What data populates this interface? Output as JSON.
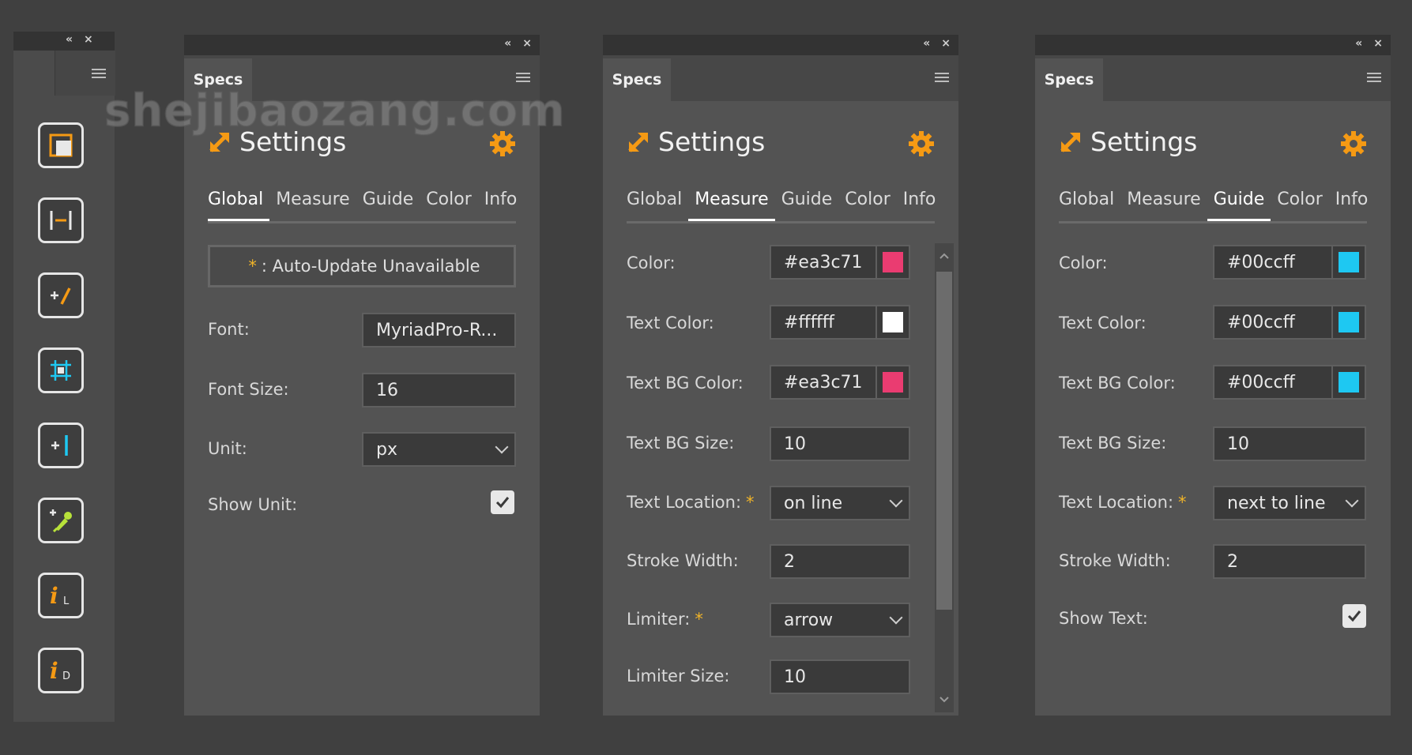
{
  "header_glyphs": {
    "collapse": "«",
    "close": "×"
  },
  "watermark": "shejibaozang.com",
  "toolbar": {
    "tools": [
      {
        "name": "artboard-tool-icon"
      },
      {
        "name": "measure-width-tool-icon"
      },
      {
        "name": "add-measure-tool-icon"
      },
      {
        "name": "measure-selection-tool-icon"
      },
      {
        "name": "add-guide-tool-icon"
      },
      {
        "name": "color-picker-tool-icon"
      },
      {
        "name": "info-layer-tool-icon",
        "glyph": "i",
        "sub": "L"
      },
      {
        "name": "info-doc-tool-icon",
        "glyph": "i",
        "sub": "D"
      }
    ]
  },
  "panels": {
    "global": {
      "tab": "Specs",
      "title": "Settings",
      "subtabs": [
        "Global",
        "Measure",
        "Guide",
        "Color",
        "Info"
      ],
      "notice": {
        "star": "*",
        "text": ": Auto-Update Unavailable"
      },
      "fields": {
        "font": {
          "label": "Font:",
          "value": "MyriadPro-R..."
        },
        "font_size": {
          "label": "Font Size:",
          "value": "16"
        },
        "unit": {
          "label": "Unit:",
          "value": "px"
        },
        "show_unit": {
          "label": "Show Unit:",
          "checked": true
        }
      }
    },
    "measure": {
      "tab": "Specs",
      "title": "Settings",
      "subtabs": [
        "Global",
        "Measure",
        "Guide",
        "Color",
        "Info"
      ],
      "fields": {
        "color": {
          "label": "Color:",
          "value": "#ea3c71",
          "swatch": "#ea3c71"
        },
        "text_color": {
          "label": "Text Color:",
          "value": "#ffffff",
          "swatch": "#ffffff"
        },
        "text_bg_color": {
          "label": "Text BG Color:",
          "value": "#ea3c71",
          "swatch": "#ea3c71"
        },
        "text_bg_size": {
          "label": "Text BG Size:",
          "value": "10"
        },
        "text_location": {
          "label": "Text Location:",
          "star": "*",
          "value": "on line"
        },
        "stroke_width": {
          "label": "Stroke Width:",
          "value": "2"
        },
        "limiter": {
          "label": "Limiter:",
          "star": "*",
          "value": "arrow"
        },
        "limiter_size": {
          "label": "Limiter Size:",
          "value": "10"
        }
      }
    },
    "guide": {
      "tab": "Specs",
      "title": "Settings",
      "subtabs": [
        "Global",
        "Measure",
        "Guide",
        "Color",
        "Info"
      ],
      "fields": {
        "color": {
          "label": "Color:",
          "value": "#00ccff",
          "swatch": "#1ec8f2"
        },
        "text_color": {
          "label": "Text Color:",
          "value": "#00ccff",
          "swatch": "#1ec8f2"
        },
        "text_bg_color": {
          "label": "Text BG Color:",
          "value": "#00ccff",
          "swatch": "#1ec8f2"
        },
        "text_bg_size": {
          "label": "Text BG Size:",
          "value": "10"
        },
        "text_location": {
          "label": "Text Location:",
          "star": "*",
          "value": "next to line"
        },
        "stroke_width": {
          "label": "Stroke Width:",
          "value": "2"
        },
        "show_text": {
          "label": "Show Text:",
          "checked": true
        }
      }
    }
  },
  "colors": {
    "accent": "#f59a14",
    "background": "#404040",
    "panel": "#535353"
  }
}
